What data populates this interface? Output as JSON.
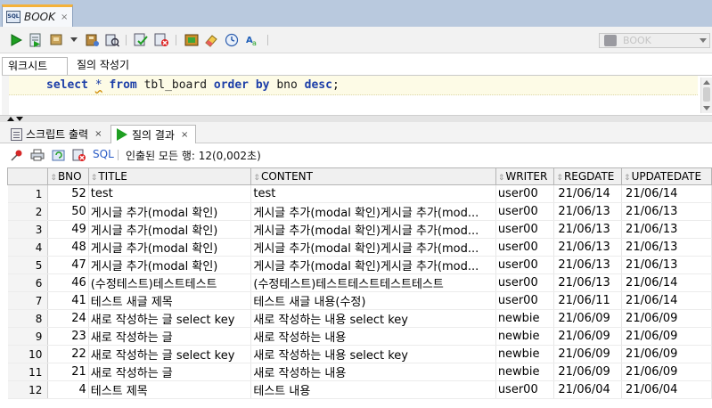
{
  "document_tab": {
    "label": "BOOK",
    "icon": "sql-worksheet-icon",
    "close": "×"
  },
  "toolbar": {
    "connection": "BOOK",
    "buttons": [
      "run-statement",
      "run-script",
      "autotrace",
      "dropdown",
      "explain-plan",
      "sql-tuning",
      "commit",
      "rollback",
      "unshared-sql",
      "clear",
      "sql-history",
      "format"
    ]
  },
  "subtabs": {
    "worksheet": "워크시트",
    "query_builder": "질의 작성기"
  },
  "editor": {
    "sql_parts": {
      "select": "select",
      "star": "*",
      "from": "from",
      "table": "tbl_board",
      "order": "order",
      "by": "by",
      "col": "bno",
      "desc": "desc",
      "semi": ";"
    }
  },
  "output_tabs": {
    "script_output": "스크립트 출력",
    "query_result": "질의 결과",
    "close": "×"
  },
  "result_toolbar": {
    "sql_label": "SQL",
    "status": "인출된 모든 행: 12(0,002초)"
  },
  "grid": {
    "columns": [
      "BNO",
      "TITLE",
      "CONTENT",
      "WRITER",
      "REGDATE",
      "UPDATEDATE"
    ],
    "rows": [
      [
        "1",
        "52",
        "test",
        "test",
        "user00",
        "21/06/14",
        "21/06/14"
      ],
      [
        "2",
        "50",
        "게시글 추가(modal 확인)",
        "게시글 추가(modal 확인)게시글 추가(mod...",
        "user00",
        "21/06/13",
        "21/06/13"
      ],
      [
        "3",
        "49",
        "게시글 추가(modal 확인)",
        "게시글 추가(modal 확인)게시글 추가(mod...",
        "user00",
        "21/06/13",
        "21/06/13"
      ],
      [
        "4",
        "48",
        "게시글 추가(modal 확인)",
        "게시글 추가(modal 확인)게시글 추가(mod...",
        "user00",
        "21/06/13",
        "21/06/13"
      ],
      [
        "5",
        "47",
        "게시글 추가(modal 확인)",
        "게시글 추가(modal 확인)게시글 추가(mod...",
        "user00",
        "21/06/13",
        "21/06/13"
      ],
      [
        "6",
        "46",
        "(수정테스트)테스트테스트",
        "(수정테스트)테스트테스트테스트테스트",
        "user00",
        "21/06/13",
        "21/06/14"
      ],
      [
        "7",
        "41",
        "테스트 새글 제목",
        "테스트 새글 내용(수정)",
        "user00",
        "21/06/11",
        "21/06/14"
      ],
      [
        "8",
        "24",
        "새로 작성하는 글 select key",
        "새로 작성하는 내용 select key",
        "newbie",
        "21/06/09",
        "21/06/09"
      ],
      [
        "9",
        "23",
        "새로 작성하는 글",
        "새로 작성하는 내용",
        "newbie",
        "21/06/09",
        "21/06/09"
      ],
      [
        "10",
        "22",
        "새로 작성하는 글 select key",
        "새로 작성하는 내용 select key",
        "newbie",
        "21/06/09",
        "21/06/09"
      ],
      [
        "11",
        "21",
        "새로 작성하는 글",
        "새로 작성하는 내용",
        "newbie",
        "21/06/09",
        "21/06/09"
      ],
      [
        "12",
        "4",
        "테스트 제목",
        "테스트 내용",
        "user00",
        "21/06/04",
        "21/06/04"
      ]
    ]
  },
  "colors": {
    "tabstrip": "#b9c9de",
    "keyword": "#1c3ea8",
    "run_green": "#1f9f22",
    "current_line": "#fdfbe6"
  }
}
